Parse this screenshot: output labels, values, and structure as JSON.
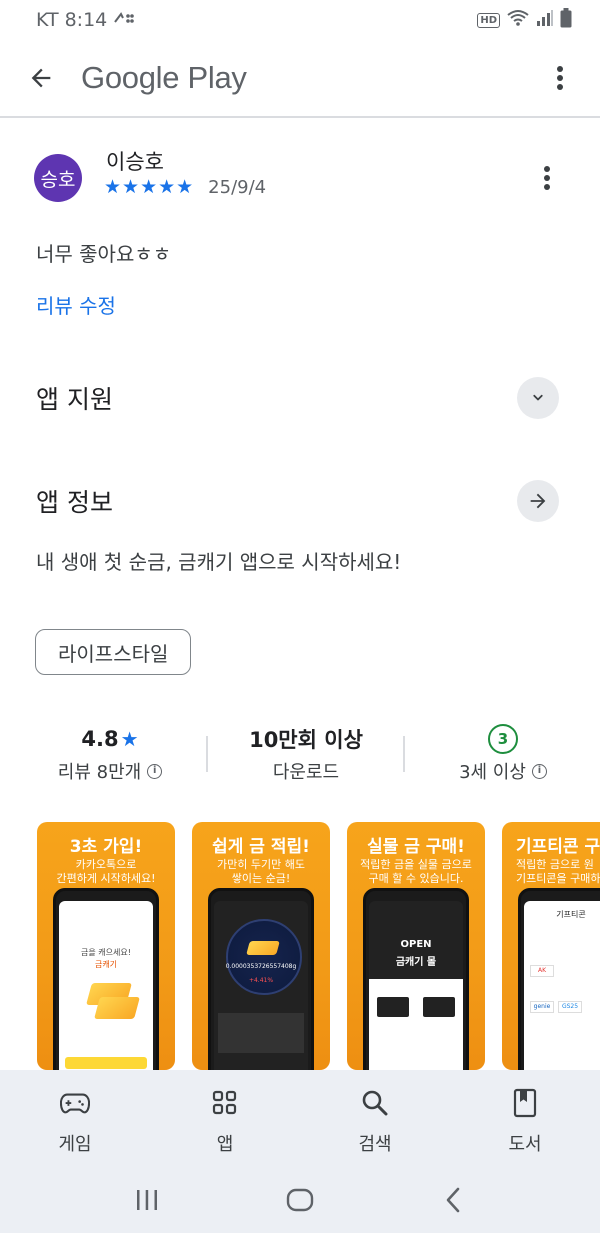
{
  "status_bar": {
    "carrier": "KT",
    "time": "8:14",
    "hd": "HD"
  },
  "app_bar": {
    "title": "Google Play"
  },
  "review": {
    "avatar_text": "승호",
    "avatar_color": "#5e35b1",
    "reviewer": "이승호",
    "stars": "★★★★★",
    "rating": 5,
    "date": "25/9/4",
    "text": "너무 좋아요ㅎㅎ",
    "edit_label": "리뷰 수정"
  },
  "sections": {
    "app_support": "앱 지원",
    "app_info": "앱 정보",
    "app_description": "내 생애 첫 순금, 금캐기 앱으로 시작하세요!"
  },
  "category_chip": "라이프스타일",
  "stats": {
    "rating_value": "4.8",
    "rating_label": "리뷰 8만개",
    "downloads_value": "10만회 이상",
    "downloads_label": "다운로드",
    "age_value": "3",
    "age_label": "3세 이상"
  },
  "screenshots": [
    {
      "title": "3초 가입!",
      "subtitle_1": "카카오톡으로",
      "subtitle_2": "간편하게 시작하세요!",
      "screen_text_1": "금을 캐으세요!",
      "screen_text_2": "금캐기"
    },
    {
      "title": "쉽게 금 적립!",
      "subtitle_1": "가만히 두기만 해도",
      "subtitle_2": "쌓이는 순금!",
      "screen_value": "0.0000353726557408g",
      "screen_rate": "+4.41%"
    },
    {
      "title": "실물 금 구매!",
      "subtitle_1": "적립한 금을 실물 금으로",
      "subtitle_2": "구매 할 수 있습니다.",
      "screen_open": "OPEN",
      "screen_mall": "금캐기 몰"
    },
    {
      "title": "기프티콘 구",
      "subtitle_1": "적립한 금으로 원",
      "subtitle_2": "기프티콘을 구매하",
      "screen_header": "기프티콘",
      "brand_1": "AK",
      "brand_2": "genie",
      "brand_3": "GS25"
    }
  ],
  "bottom_nav": [
    {
      "label": "게임",
      "icon": "gamepad-icon"
    },
    {
      "label": "앱",
      "icon": "apps-grid-icon"
    },
    {
      "label": "검색",
      "icon": "search-icon"
    },
    {
      "label": "도서",
      "icon": "book-icon"
    }
  ],
  "colors": {
    "accent": "#1a73e8",
    "age_green": "#1e8e3e",
    "nav_bg": "#eceff4",
    "shot_orange": "#f29a17"
  }
}
